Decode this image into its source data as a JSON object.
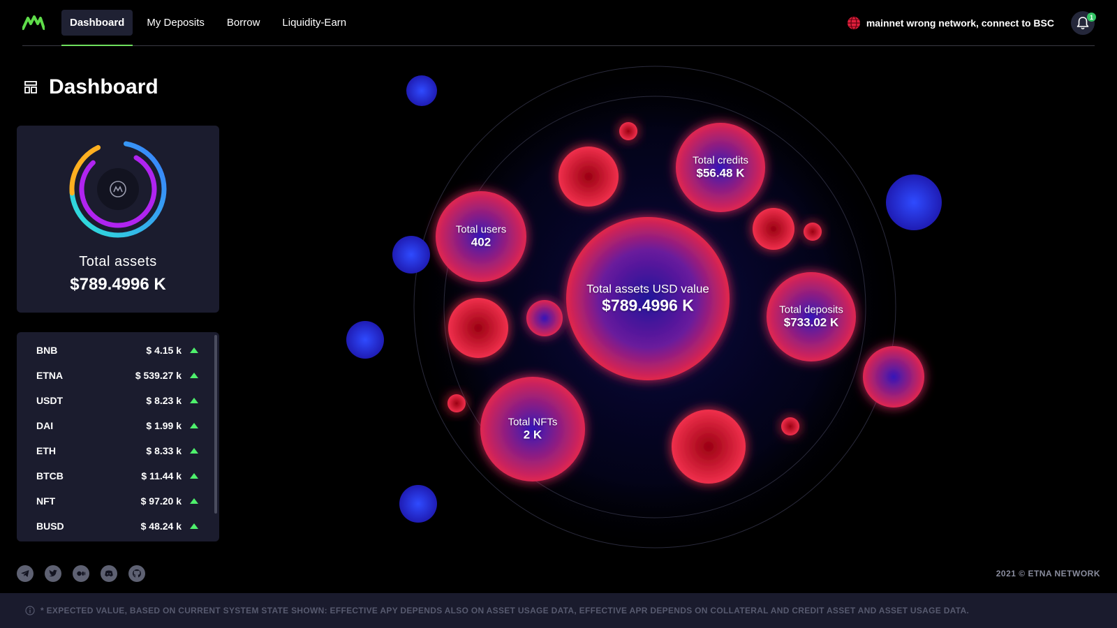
{
  "nav": {
    "items": [
      {
        "label": "Dashboard",
        "active": true
      },
      {
        "label": "My Deposits",
        "active": false
      },
      {
        "label": "Borrow",
        "active": false
      },
      {
        "label": "Liquidity-Earn",
        "active": false
      }
    ],
    "network_status": "mainnet wrong network, connect to BSC",
    "notification_count": "1"
  },
  "page": {
    "title": "Dashboard"
  },
  "assets_card": {
    "label": "Total assets",
    "value": "$789.4996 K"
  },
  "tokens": [
    {
      "name": "BNB",
      "value": "$ 4.15 k"
    },
    {
      "name": "ETNA",
      "value": "$ 539.27 k"
    },
    {
      "name": "USDT",
      "value": "$ 8.23 k"
    },
    {
      "name": "DAI",
      "value": "$ 1.99 k"
    },
    {
      "name": "ETH",
      "value": "$ 8.33 k"
    },
    {
      "name": "BTCB",
      "value": "$ 11.44 k"
    },
    {
      "name": "NFT",
      "value": "$ 97.20 k"
    },
    {
      "name": "BUSD",
      "value": "$ 48.24 k"
    }
  ],
  "bubbles": {
    "center": {
      "title": "Total assets USD value",
      "value": "$789.4996 K"
    },
    "users": {
      "title": "Total users",
      "value": "402"
    },
    "credits": {
      "title": "Total credits",
      "value": "$56.48 K"
    },
    "deposits": {
      "title": "Total deposits",
      "value": "$733.02 K"
    },
    "nfts": {
      "title": "Total NFTs",
      "value": "2 K"
    }
  },
  "footer": {
    "copyright": "2021 © ETNA NETWORK",
    "disclaimer": "* EXPECTED VALUE, BASED ON CURRENT SYSTEM STATE SHOWN: EFFECTIVE APY DEPENDS ALSO ON ASSET USAGE DATA, EFFECTIVE APR DEPENDS ON COLLATERAL AND CREDIT ASSET AND ASSET USAGE DATA."
  },
  "colors": {
    "accent_green": "#6ee05e",
    "bubble_red": "#e0203c",
    "bubble_blue": "#2a2ee0",
    "card_bg": "#1b1c2e"
  }
}
